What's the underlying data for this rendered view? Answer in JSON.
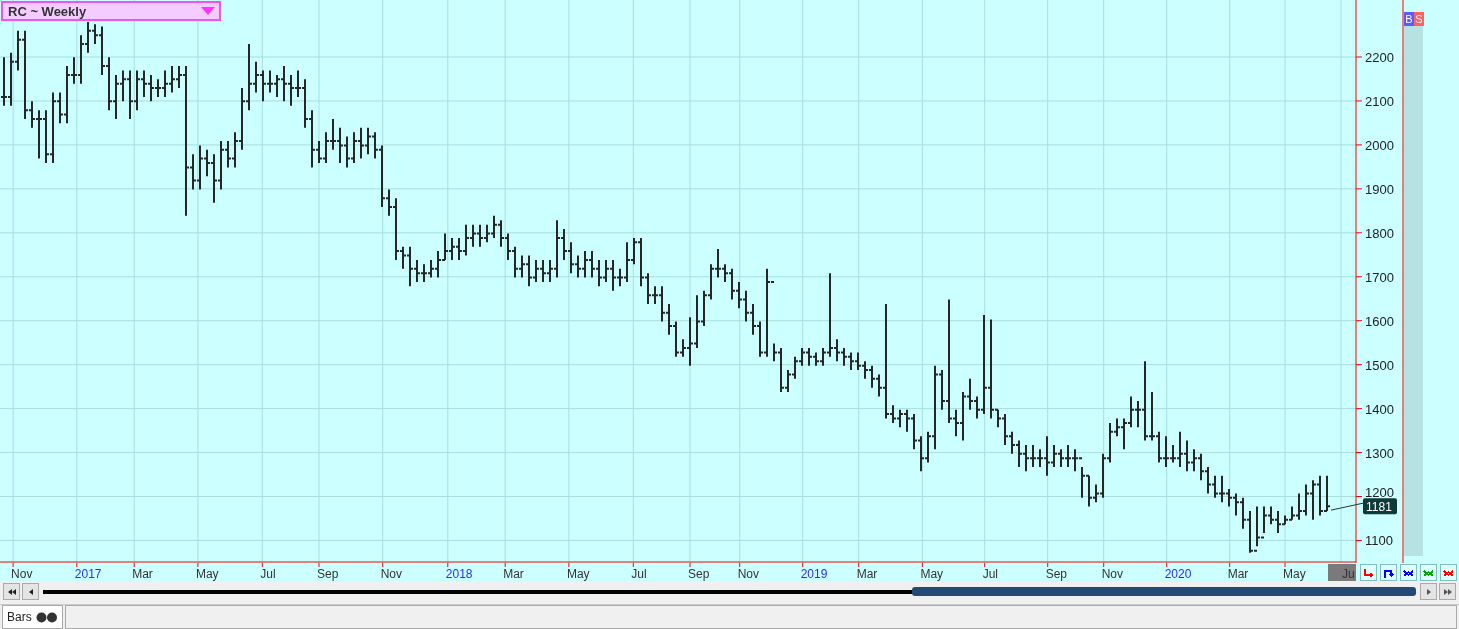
{
  "chart_selector": {
    "label": "RC ~ Weekly"
  },
  "signal_flags": [
    {
      "label": "B",
      "color": "#5a5aff"
    },
    {
      "label": "S",
      "color": "#ff6060"
    }
  ],
  "chart": {
    "last_price": "1181",
    "range_marker": "Ju",
    "price_axis": [
      "2200",
      "2100",
      "2000",
      "1900",
      "1800",
      "1700",
      "1600",
      "1500",
      "1400",
      "1300",
      "1200",
      "1100"
    ],
    "time_axis": [
      {
        "label": "Nov",
        "kind": "month"
      },
      {
        "label": "2017",
        "kind": "year"
      },
      {
        "label": "Mar",
        "kind": "month"
      },
      {
        "label": "May",
        "kind": "month"
      },
      {
        "label": "Jul",
        "kind": "month"
      },
      {
        "label": "Sep",
        "kind": "month"
      },
      {
        "label": "Nov",
        "kind": "month"
      },
      {
        "label": "2018",
        "kind": "year"
      },
      {
        "label": "Mar",
        "kind": "month"
      },
      {
        "label": "May",
        "kind": "month"
      },
      {
        "label": "Jul",
        "kind": "month"
      },
      {
        "label": "Sep",
        "kind": "month"
      },
      {
        "label": "Nov",
        "kind": "month"
      },
      {
        "label": "2019",
        "kind": "year"
      },
      {
        "label": "Mar",
        "kind": "month"
      },
      {
        "label": "May",
        "kind": "month"
      },
      {
        "label": "Jul",
        "kind": "month"
      },
      {
        "label": "Sep",
        "kind": "month"
      },
      {
        "label": "Nov",
        "kind": "month"
      },
      {
        "label": "2020",
        "kind": "year"
      },
      {
        "label": "Mar",
        "kind": "month"
      },
      {
        "label": "May",
        "kind": "month"
      }
    ]
  },
  "tool_buttons": [
    {
      "kind": "hook",
      "color": "#ff0000"
    },
    {
      "kind": "step",
      "color": "#0000ff"
    },
    {
      "kind": "cross",
      "color": "#0000ff"
    },
    {
      "kind": "cross",
      "color": "#00aa00"
    },
    {
      "kind": "cross",
      "color": "#ff0000"
    }
  ],
  "status_bar": {
    "view_tab": "Bars"
  }
}
